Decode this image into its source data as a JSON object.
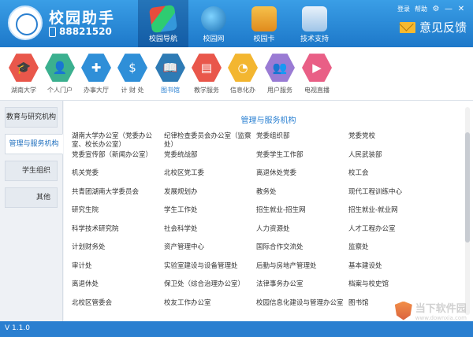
{
  "header": {
    "title": "校园助手",
    "phone": "88821520",
    "links": {
      "login": "登录",
      "help": "帮助"
    },
    "feedback": "意见反馈",
    "nav": [
      {
        "label": "校园导航",
        "icon": "campus-nav-icon"
      },
      {
        "label": "校园网",
        "icon": "globe-icon"
      },
      {
        "label": "校园卡",
        "icon": "card-icon"
      },
      {
        "label": "技术支持",
        "icon": "books-icon"
      }
    ]
  },
  "categories": [
    {
      "label": "湖南大学",
      "icon": "graduation-cap-icon",
      "color": "#e9574b",
      "glyph": "🎓"
    },
    {
      "label": "个人门户",
      "icon": "person-icon",
      "color": "#3bb08f",
      "glyph": "👤"
    },
    {
      "label": "办事大厅",
      "icon": "puzzle-icon",
      "color": "#2f8fd8",
      "glyph": "✚"
    },
    {
      "label": "计 财 处",
      "icon": "money-bag-icon",
      "color": "#2f8fd8",
      "glyph": "$"
    },
    {
      "label": "图书馆",
      "icon": "book-icon",
      "color": "#2e7bb5",
      "glyph": "📖"
    },
    {
      "label": "教学服务",
      "icon": "teaching-icon",
      "color": "#e9574b",
      "glyph": "▤"
    },
    {
      "label": "信息化办",
      "icon": "pie-chart-icon",
      "color": "#f3b630",
      "glyph": "◔"
    },
    {
      "label": "用户服务",
      "icon": "users-icon",
      "color": "#9a7bd4",
      "glyph": "👥"
    },
    {
      "label": "电视直播",
      "icon": "tv-icon",
      "color": "#e95f86",
      "glyph": "▶"
    }
  ],
  "sidebar": [
    {
      "label": "教育与研究机构"
    },
    {
      "label": "管理与服务机构"
    },
    {
      "label": "学生组织"
    },
    {
      "label": "其他"
    }
  ],
  "content": {
    "title": "管理与服务机构",
    "items": [
      "湖南大学办公室（党委办公室、校长办公室）",
      "纪律检查委员会办公室（监察处）",
      "党委组织部",
      "党委党校",
      "党委宣传部（新闻办公室）",
      "党委统战部",
      "党委学生工作部",
      "人民武装部",
      "机关党委",
      "北校区党工委",
      "离退休处党委",
      "校工会",
      "共青团湖南大学委员会",
      "发展规划办",
      "教务处",
      "现代工程训练中心",
      "研究生院",
      "学生工作处",
      "招生就业-招生网",
      "招生就业-就业网",
      "科学技术研究院",
      "社会科学处",
      "人力资源处",
      "人才工程办公室",
      "计划财务处",
      "资产管理中心",
      "国际合作交流处",
      "监察处",
      "审计处",
      "实验室建设与设备管理处",
      "后勤与房地产管理处",
      "基本建设处",
      "离退休处",
      "保卫处（综合治理办公室）",
      "法律事务办公室",
      "档案与校史馆",
      "北校区管委会",
      "校友工作办公室",
      "校园信息化建设与管理办公室",
      "图书馆"
    ]
  },
  "footer": {
    "version": "V 1.1.0"
  },
  "watermark": {
    "main": "当下软件园",
    "sub": "www.downxia.com"
  }
}
